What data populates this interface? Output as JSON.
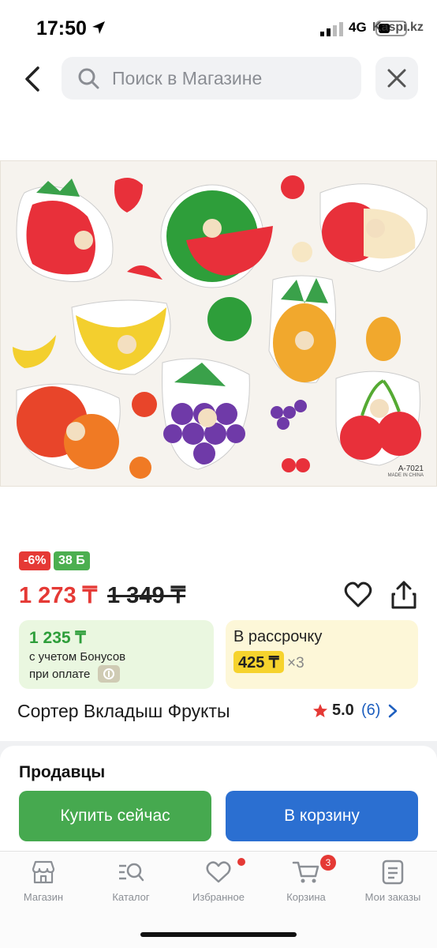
{
  "status_bar": {
    "time": "17:50",
    "network": "4G",
    "watermark": "Kaspi.kz"
  },
  "search": {
    "placeholder": "Поиск в Магазине"
  },
  "product_image": {
    "code": "A-7021",
    "made_in": "MADE IN CHINA"
  },
  "badges": {
    "discount": "-6%",
    "bonus": "38 Б"
  },
  "price": {
    "current": "1 273 ₸",
    "old": "1 349 ₸"
  },
  "bonus_card": {
    "amount": "1 235 ₸",
    "line1": "с учетом Бонусов",
    "line2": "при оплате"
  },
  "installment_card": {
    "title": "В рассрочку",
    "price": "425 ₸",
    "multiplier": "×3"
  },
  "product": {
    "title": "Сортер Вкладыш Фрукты",
    "rating": "5.0",
    "reviews": "(6)"
  },
  "sellers": {
    "heading": "Продавцы"
  },
  "buttons": {
    "buy_now": "Купить сейчас",
    "add_to_cart": "В корзину"
  },
  "nav": {
    "items": [
      {
        "label": "Магазин",
        "icon": "store-icon"
      },
      {
        "label": "Каталог",
        "icon": "catalog-icon"
      },
      {
        "label": "Избранное",
        "icon": "heart-icon"
      },
      {
        "label": "Корзина",
        "icon": "cart-icon",
        "badge": "3"
      },
      {
        "label": "Мои заказы",
        "icon": "orders-icon"
      }
    ]
  },
  "colors": {
    "accent_red": "#e53935",
    "green": "#46a94f",
    "blue": "#2b6fd1",
    "link": "#1e5fbf"
  }
}
